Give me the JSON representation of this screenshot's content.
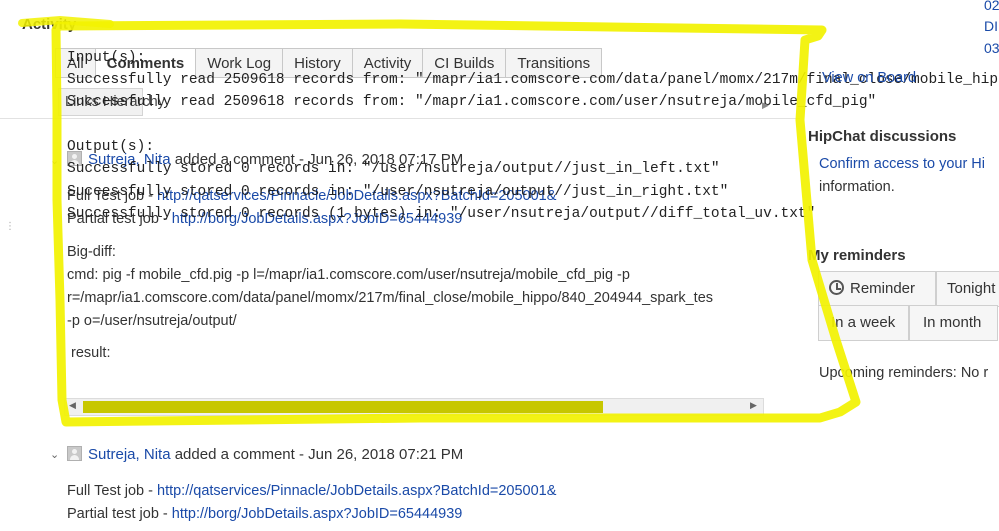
{
  "activity": {
    "title": "Activity",
    "tabs": [
      {
        "label": "All",
        "active": false
      },
      {
        "label": "Comments",
        "active": true
      },
      {
        "label": "Work Log",
        "active": false
      },
      {
        "label": "History",
        "active": false
      },
      {
        "label": "Activity",
        "active": false
      },
      {
        "label": "CI Builds",
        "active": false
      },
      {
        "label": "Transitions",
        "active": false
      }
    ],
    "links_hierarchy": "Links Hierarchy"
  },
  "overlay_log": {
    "input_header": "Input(s):",
    "input_lines": [
      "Successfully read 2509618 records from: \"/mapr/ia1.comscore.com/data/panel/momx/217m/final_close/mobile_hippo",
      "Successfully read 2509618 records from: \"/mapr/ia1.comscore.com/user/nsutreja/mobile_cfd_pig\""
    ],
    "output_header": "Output(s):",
    "output_lines": [
      "Successfully stored 0 records in: \"/user/nsutreja/output//just_in_left.txt\"",
      "Successfully stored 0 records in: \"/user/nsutreja/output//just_in_right.txt\"",
      "Successfully stored 0 records (1 bytes) in: \"/user/nsutreja/output//diff_total_uv.txt\""
    ]
  },
  "comment1": {
    "author": "Sutreja, Nita",
    "action": "added a comment - Jun 26, 2018 07:17 PM",
    "full_test_label": "Full Test job - ",
    "full_test_url": "http://qatservices/Pinnacle/JobDetails.aspx?BatchId=205001&",
    "partial_test_label": "Partial test job - ",
    "partial_test_url": "http://borg/JobDetails.aspx?JobID=65444939",
    "bigdiff": "Big-diff:",
    "cmd_line1": "cmd: pig -f mobile_cfd.pig -p l=/mapr/ia1.comscore.com/user/nsutreja/mobile_cfd_pig -p",
    "cmd_line2": "r=/mapr/ia1.comscore.com/data/panel/momx/217m/final_close/mobile_hippo/840_204944_spark_tes",
    "cmd_line3": "-p o=/user/nsutreja/output/",
    "result": "result:"
  },
  "comment2": {
    "author": "Sutreja, Nita",
    "action": "added a comment - Jun 26, 2018 07:21 PM",
    "full_test_label": "Full Test job - ",
    "full_test_url": "http://qatservices/Pinnacle/JobDetails.aspx?BatchId=205001&",
    "partial_test_label": "Partial test job - ",
    "partial_test_url": "http://borg/JobDetails.aspx?JobID=65444939"
  },
  "right_panel": {
    "top_links": [
      "02",
      "DI",
      "03"
    ],
    "view_on_board": "View on Board",
    "hipchat_title": "HipChat discussions",
    "hipchat_link": "Confirm access to your Hi",
    "hipchat_text": "information.",
    "reminders_title": "My reminders",
    "reminder_button": "Reminder",
    "tonight_button": "Tonight",
    "week_button": "In a week",
    "month_button": "In month",
    "upcoming": "Upcoming reminders: No r"
  },
  "colors": {
    "highlight": "#f2f200",
    "link": "#1a4aa8",
    "scrollbar_thumb": "#c7c700"
  }
}
